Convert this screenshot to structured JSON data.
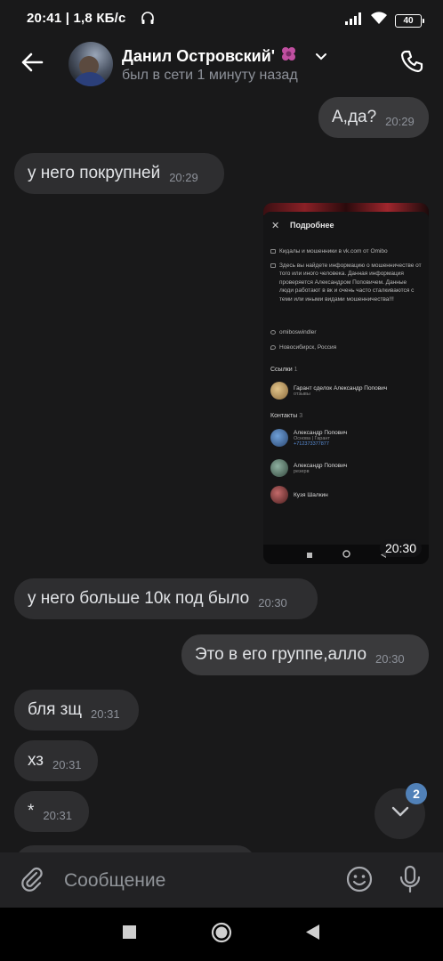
{
  "status_bar": {
    "time_speed": "20:41 | 1,8 КБ/с",
    "battery": "40"
  },
  "header": {
    "contact_name": "Данил Островский'",
    "last_seen": "был в сети 1 минуту назад",
    "icons": [
      "arrow-left-icon",
      "flower-emoji-icon",
      "chevron-down-icon",
      "phone-icon"
    ]
  },
  "messages": [
    {
      "dir": "out",
      "text": "А,да?",
      "time": "20:29"
    },
    {
      "dir": "in",
      "text": "у него покрупней",
      "time": "20:29"
    },
    {
      "dir": "in",
      "type": "photo",
      "time": "20:30"
    },
    {
      "dir": "in",
      "text": "у него больше 10к под было",
      "time": "20:30"
    },
    {
      "dir": "out",
      "text": "Это в его группе,алло",
      "time": "20:30"
    },
    {
      "dir": "in",
      "text": "бля зщ",
      "time": "20:31"
    },
    {
      "dir": "in",
      "text": "хз",
      "time": "20:31"
    },
    {
      "dir": "in",
      "text": "*",
      "time": "20:31"
    }
  ],
  "screenshot": {
    "title": "Подробнее",
    "rows": [
      "Кидалы и мошенники в vk.com от Omibo",
      "Здесь вы найдете информацию о мошенничестве от того или иного человека. Данная информация проверяется Александром Поповичем. Данные люди работают в вк и очень часто сталкиваются с теми или иными видами мошенничества!!!",
      "omiboswindler",
      "Новосибирск, Россия"
    ],
    "links_label": "Ссылки",
    "links_count": "1",
    "links": [
      {
        "title": "Гарант сделок Александр Попович",
        "sub": "отзывы"
      }
    ],
    "contacts_label": "Контакты",
    "contacts_count": "3",
    "contacts": [
      {
        "name": "Александр Попович",
        "sub1": "Основа | Гарант",
        "sub2": "+712373377877"
      },
      {
        "name": "Александр Попович",
        "sub1": "резерв",
        "sub2": ""
      },
      {
        "name": "Кузя Шалкин",
        "sub1": "",
        "sub2": ""
      }
    ]
  },
  "scroll_down": {
    "badge": "2"
  },
  "composer": {
    "placeholder": "Сообщение"
  },
  "accent_color": "#5181b8"
}
